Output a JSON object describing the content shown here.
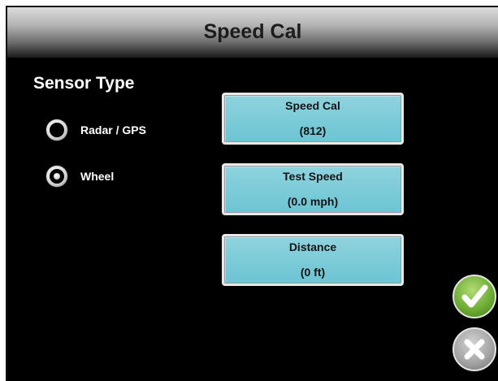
{
  "header": {
    "title": "Speed Cal"
  },
  "sensor_type": {
    "heading": "Sensor Type",
    "options": [
      {
        "label": "Radar / GPS",
        "selected": false
      },
      {
        "label": "Wheel",
        "selected": true
      }
    ]
  },
  "fields": [
    {
      "label": "Speed Cal",
      "value": "(812)"
    },
    {
      "label": "Test Speed",
      "value": "(0.0 mph)"
    },
    {
      "label": "Distance",
      "value": "(0 ft)"
    }
  ],
  "actions": {
    "accept_icon": "checkmark-icon",
    "cancel_icon": "x-icon"
  },
  "colors": {
    "background": "#000000",
    "field_button": "#7ccad7",
    "accept": "#6fae35",
    "cancel": "#a6a6a6",
    "text_light": "#ffffff"
  }
}
